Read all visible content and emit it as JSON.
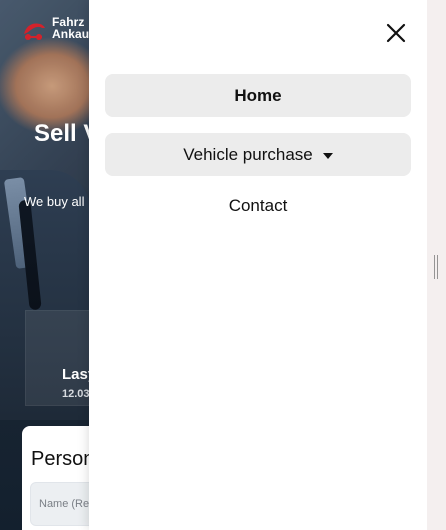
{
  "background": {
    "logo_text_line1": "Fahrz",
    "logo_text_line2": "Ankau",
    "hero_title": "Sell V",
    "hero_subtitle": "We buy all",
    "card_title": "Lasy",
    "card_date": "12.03",
    "form_title": "Person",
    "form_input_placeholder": "Name (Re"
  },
  "drawer": {
    "close_icon": "close-icon",
    "items": [
      {
        "label": "Home"
      },
      {
        "label": "Vehicle purchase",
        "has_dropdown": true
      },
      {
        "label": "Contact"
      }
    ]
  },
  "colors": {
    "logo_accent": "#d3222b",
    "drawer_bg": "#ffffff",
    "nav_button_bg": "#ececec",
    "page_bg": "#f2eeee"
  }
}
